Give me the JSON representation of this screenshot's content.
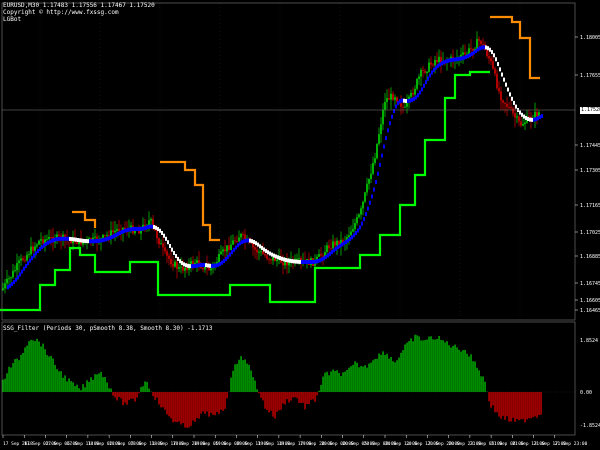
{
  "header": {
    "symbol_line": "EURUSD,M30  1.17483 1.17556 1.17467 1.17520",
    "copyright": "Copyright © http://www.fxssg.com",
    "tag": "LGBot"
  },
  "indicator": {
    "label": "SSG_Filter (Periods 30, pSmooth 8.38, Smooth 8.30)  -1.1713"
  },
  "current_price": "1.17520",
  "colors": {
    "bull_candle": "#00ff00",
    "bear_candle": "#ff0000",
    "baseline_up": "#0000ff",
    "baseline_down": "#ffffff",
    "support_line": "#00ff00",
    "resistance_line": "#ff8c00",
    "hist_positive": "#00c800",
    "hist_negative": "#e00000",
    "axis_text": "#ffffff",
    "grid_dots": "#808080"
  },
  "chart_data": [
    {
      "type": "candlestick",
      "title": "",
      "price_ticks": [
        "1.18005",
        "1.17655",
        "1.17585",
        "1.17445",
        "1.17305",
        "1.17165",
        "1.17025",
        "1.16885",
        "1.16745",
        "1.16605",
        "1.16465"
      ],
      "ylim": [
        1.164,
        1.1818
      ],
      "indicators": [
        "support-stop-line",
        "resistance-stop-line",
        "blue-white-baseline"
      ]
    },
    {
      "type": "bar",
      "title": "",
      "ticks": [
        "1.8524",
        "0.00",
        "-1.8524"
      ],
      "ylim": [
        -1.9,
        1.9
      ]
    }
  ],
  "time_axis": [
    "17 Sep 2018",
    "17 Sep 02:00",
    "17 Sep 06:00",
    "17 Sep 11:00",
    "18 Sep 02:00",
    "18 Sep 07:00",
    "18 Sep 11:00",
    "18 Sep 17:00",
    "18 Sep 20:00",
    "19 Sep 05:00",
    "19 Sep 08:00",
    "19 Sep 11:00",
    "19 Sep 14:00",
    "19 Sep 17:00",
    "19 Sep 20:00",
    "20 Sep 00:00",
    "20 Sep 05:00",
    "20 Sep 08:00",
    "20 Sep 11:00",
    "20 Sep 17:00",
    "20 Sep 20:00",
    "20 Sep 23:00",
    "21 Sep 05:00",
    "21 Sep 08:00",
    "21 Sep 13:00",
    "21 Sep 17:00",
    "21 Sep 23:00"
  ]
}
